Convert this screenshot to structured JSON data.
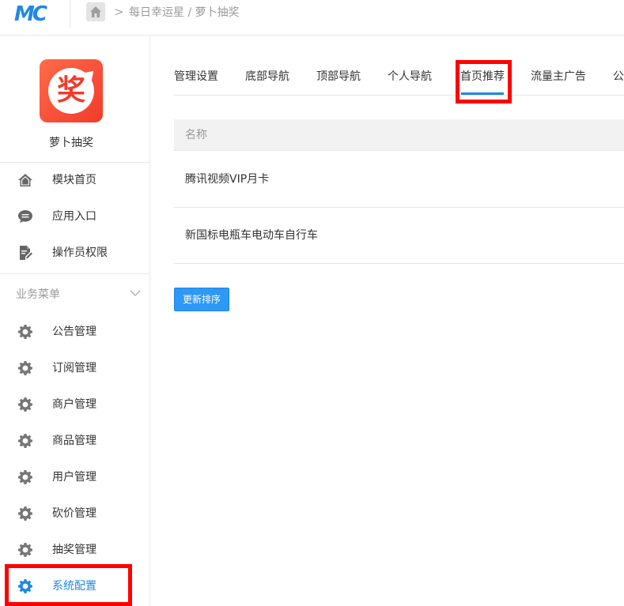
{
  "header": {
    "logo_text": "MC",
    "breadcrumb_sep": ">",
    "breadcrumb": "每日幸运星 / 萝卜抽奖"
  },
  "app": {
    "name": "萝卜抽奖",
    "logo_glyph": "奖",
    "logo_color": "#f23b2b"
  },
  "sidebar": {
    "top_items": [
      {
        "label": "模块首页",
        "icon": "home-icon"
      },
      {
        "label": "应用入口",
        "icon": "chat-icon"
      },
      {
        "label": "操作员权限",
        "icon": "document-edit-icon"
      }
    ],
    "section_label": "业务菜单",
    "biz_items": [
      {
        "label": "公告管理",
        "icon": "gear-icon"
      },
      {
        "label": "订阅管理",
        "icon": "gear-icon"
      },
      {
        "label": "商户管理",
        "icon": "gear-icon"
      },
      {
        "label": "商品管理",
        "icon": "gear-icon"
      },
      {
        "label": "用户管理",
        "icon": "gear-icon"
      },
      {
        "label": "砍价管理",
        "icon": "gear-icon"
      },
      {
        "label": "抽奖管理",
        "icon": "gear-icon"
      },
      {
        "label": "系统配置",
        "icon": "gear-icon",
        "active": true
      }
    ]
  },
  "tabs": [
    {
      "label": "管理设置"
    },
    {
      "label": "底部导航"
    },
    {
      "label": "顶部导航"
    },
    {
      "label": "个人导航"
    },
    {
      "label": "首页推荐",
      "active": true
    },
    {
      "label": "流量主广告"
    },
    {
      "label": "公"
    }
  ],
  "table": {
    "header": "名称",
    "rows": [
      "腾讯视频VIP月卡",
      "新国标电瓶车电动车自行车"
    ]
  },
  "update_button_label": "更新排序",
  "colors": {
    "accent": "#1e88e5",
    "button": "#2d98f5",
    "highlight": "#ff0000"
  }
}
